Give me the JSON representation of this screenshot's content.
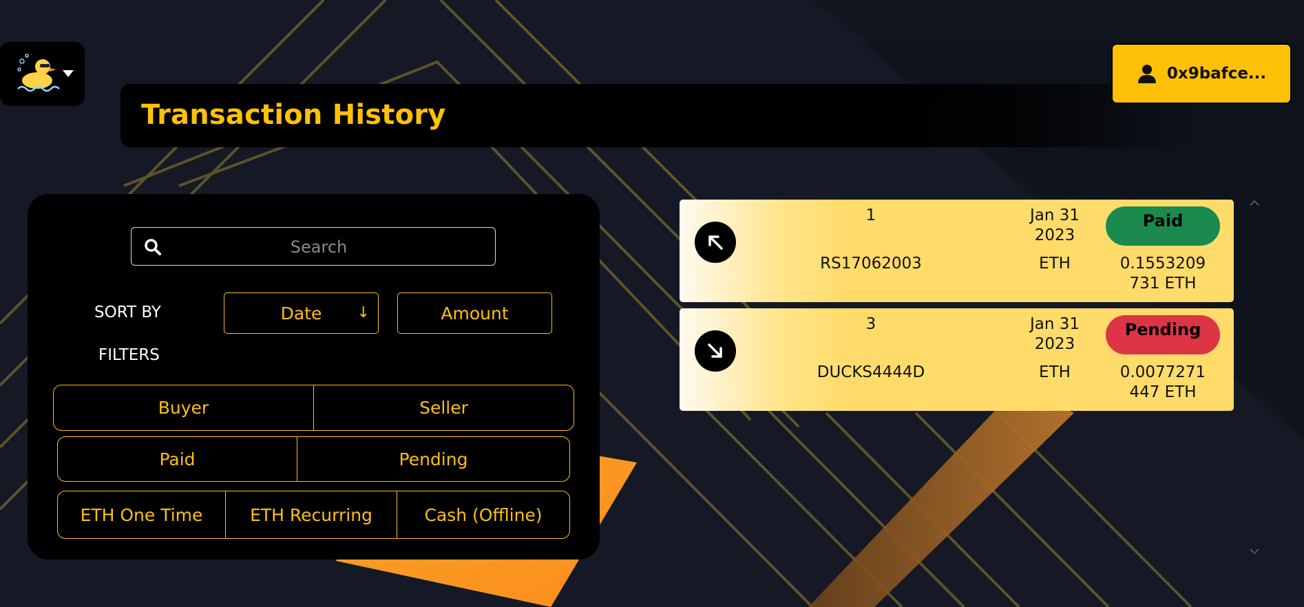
{
  "colors": {
    "accent": "#ffc107",
    "paid": "#1a8a4f",
    "pending": "#dc3545",
    "panel": "#000000",
    "background": "#141925"
  },
  "header": {
    "logo_icon": "duck-logo-icon",
    "menu_icon": "caret-down-icon",
    "wallet_icon": "user-icon",
    "wallet_label": "0x9bafce..."
  },
  "page": {
    "title": "Transaction History"
  },
  "search": {
    "icon": "search-icon",
    "placeholder": "Search",
    "value": ""
  },
  "sort": {
    "label": "SORT BY",
    "options": [
      "Date",
      "Amount"
    ],
    "active": "Date",
    "direction_icon": "arrow-down-icon",
    "direction_glyph": "↓"
  },
  "filters": {
    "label": "FILTERS",
    "role": [
      "Buyer",
      "Seller"
    ],
    "status": [
      "Paid",
      "Pending"
    ],
    "payment_type": [
      "ETH One Time",
      "ETH Recurring",
      "Cash (Offline)"
    ]
  },
  "transactions": [
    {
      "direction": "outgoing",
      "direction_icon": "arrow-up-left-icon",
      "id": "1",
      "reference": "RS17062003",
      "date_line1": "Jan 31",
      "date_line2": "2023",
      "currency": "ETH",
      "status": "Paid",
      "status_color": "#1a8a4f",
      "status_text_color": "#000000",
      "amount_line1": "0.1553209",
      "amount_line2": "731 ETH"
    },
    {
      "direction": "incoming",
      "direction_icon": "arrow-down-right-icon",
      "id": "3",
      "reference": "DUCKS4444D",
      "date_line1": "Jan 31",
      "date_line2": "2023",
      "currency": "ETH",
      "status": "Pending",
      "status_color": "#dc3545",
      "status_text_color": "#000000",
      "amount_line1": "0.0077271",
      "amount_line2": "447 ETH"
    }
  ],
  "scrollbar": {
    "up_icon": "chevron-up-icon",
    "down_icon": "chevron-down-icon"
  }
}
